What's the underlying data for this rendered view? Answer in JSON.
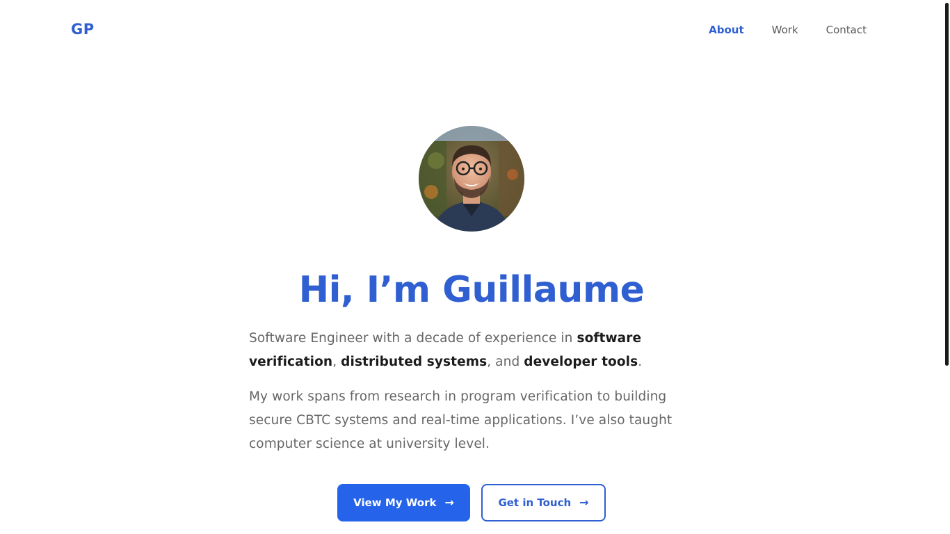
{
  "header": {
    "logo": "GP",
    "nav": [
      {
        "label": "About",
        "active": true
      },
      {
        "label": "Work",
        "active": false
      },
      {
        "label": "Contact",
        "active": false
      }
    ]
  },
  "hero": {
    "avatar_icon": "profile-photo",
    "title": "Hi, I’m Guillaume",
    "intro": {
      "prefix": "Software Engineer with a decade of experience in ",
      "skill_1": "software verification",
      "sep_1": ", ",
      "skill_2": "distributed systems",
      "sep_2": ", and ",
      "skill_3": "developer tools",
      "suffix": "."
    },
    "body": "My work spans from research in program verification to building secure CBTC systems and real-time applications. I’ve also taught computer science at university level.",
    "buttons": {
      "primary_label": "View My Work",
      "secondary_label": "Get in Touch",
      "arrow_icon": "arrow-right-icon"
    }
  },
  "colors": {
    "accent": "#2f5fd0",
    "button_primary": "#2563eb",
    "text_muted": "#666666",
    "text_strong": "#1b1b1b"
  }
}
